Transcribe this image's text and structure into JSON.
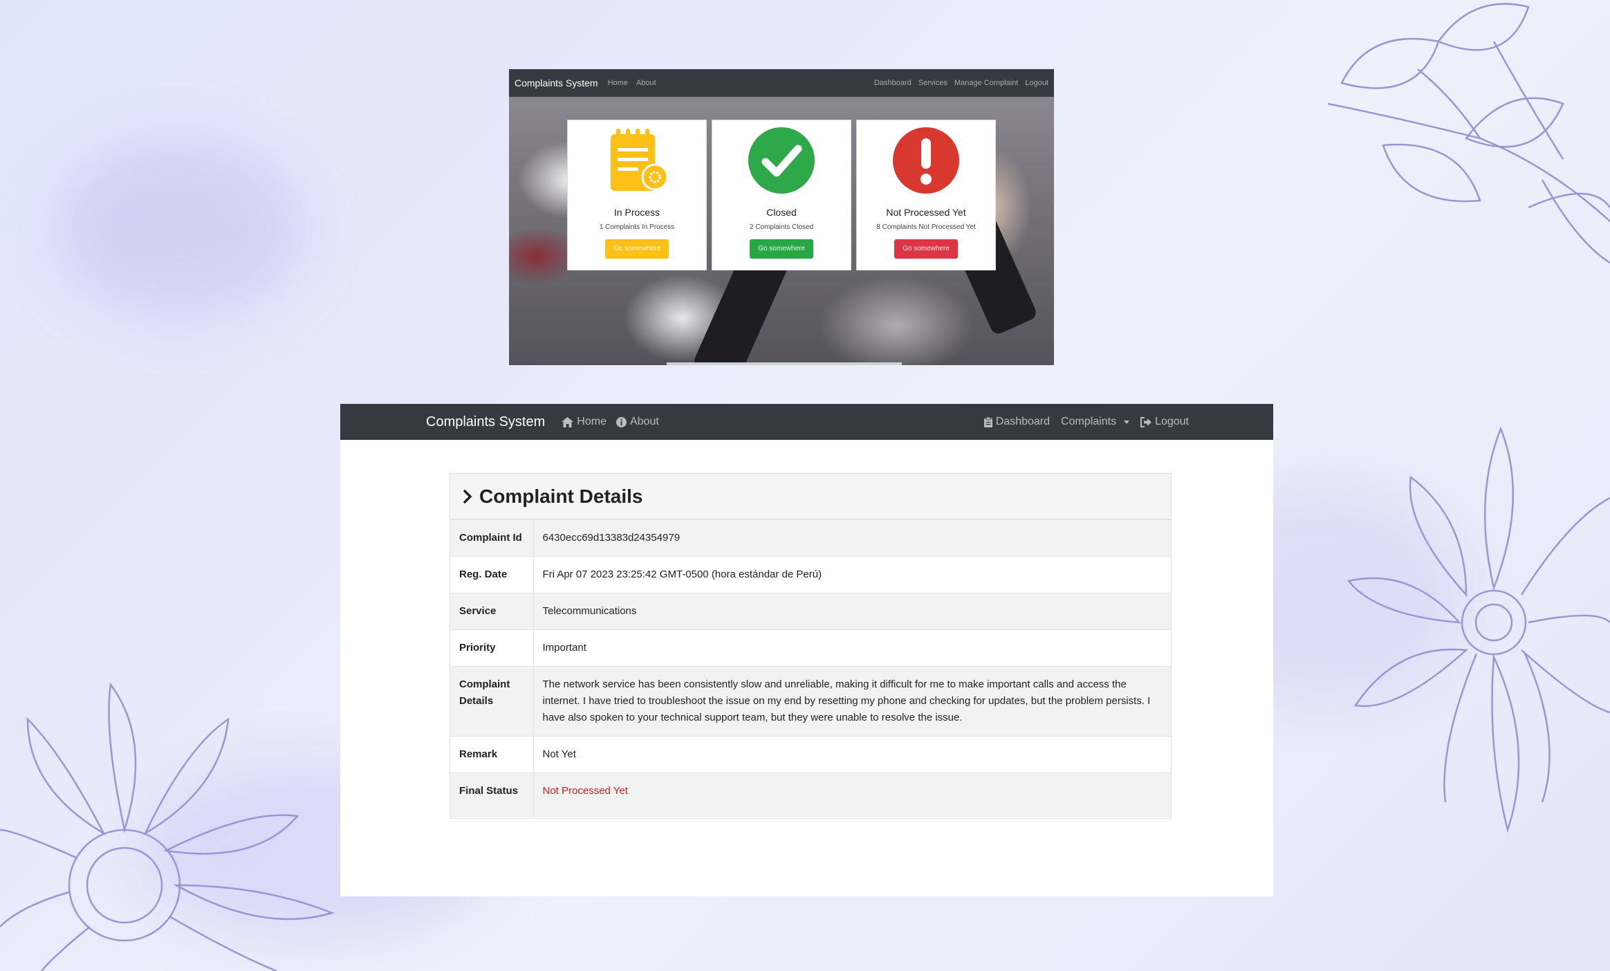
{
  "preview": {
    "brand": "Complaints System",
    "nav_left": [
      "Home",
      "About"
    ],
    "nav_right": [
      "Dashboard",
      "Services",
      "Manage Complaint",
      "Logout"
    ],
    "cards": [
      {
        "title": "In Process",
        "subtitle": "1 Complaints In Process",
        "button": "Go somewhere",
        "color": "#fdc016",
        "icon": "notepad-gear-icon"
      },
      {
        "title": "Closed",
        "subtitle": "2 Complaints Closed",
        "button": "Go somewhere",
        "color": "#28a745",
        "icon": "check-circle-icon"
      },
      {
        "title": "Not Processed Yet",
        "subtitle": "8 Complaints Not Processed Yet",
        "button": "Go somewhere",
        "color": "#dc3545",
        "icon": "exclamation-circle-icon"
      }
    ]
  },
  "navbar": {
    "brand": "Complaints System",
    "home": "Home",
    "about": "About",
    "dashboard": "Dashboard",
    "complaints": "Complaints",
    "logout": "Logout"
  },
  "panel": {
    "title": "Complaint Details",
    "rows": [
      {
        "label": "Complaint Id",
        "value": "6430ecc69d13383d24354979"
      },
      {
        "label": "Reg. Date",
        "value": "Fri Apr 07 2023 23:25:42 GMT-0500 (hora estándar de Perú)"
      },
      {
        "label": "Service",
        "value": "Telecommunications"
      },
      {
        "label": "Priority",
        "value": "Important"
      },
      {
        "label": "Complaint Details",
        "value": "The network service has been consistently slow and unreliable, making it difficult for me to make important calls and access the internet. I have tried to troubleshoot the issue on my end by resetting my phone and checking for updates, but the problem persists. I have also spoken to your technical support team, but they were unable to resolve the issue."
      },
      {
        "label": "Remark",
        "value": "Not Yet"
      },
      {
        "label": "Final Status",
        "value": "Not Processed Yet"
      }
    ]
  },
  "colors": {
    "navbar": "#343a40",
    "status_not_processed": "#cc1f1f"
  }
}
